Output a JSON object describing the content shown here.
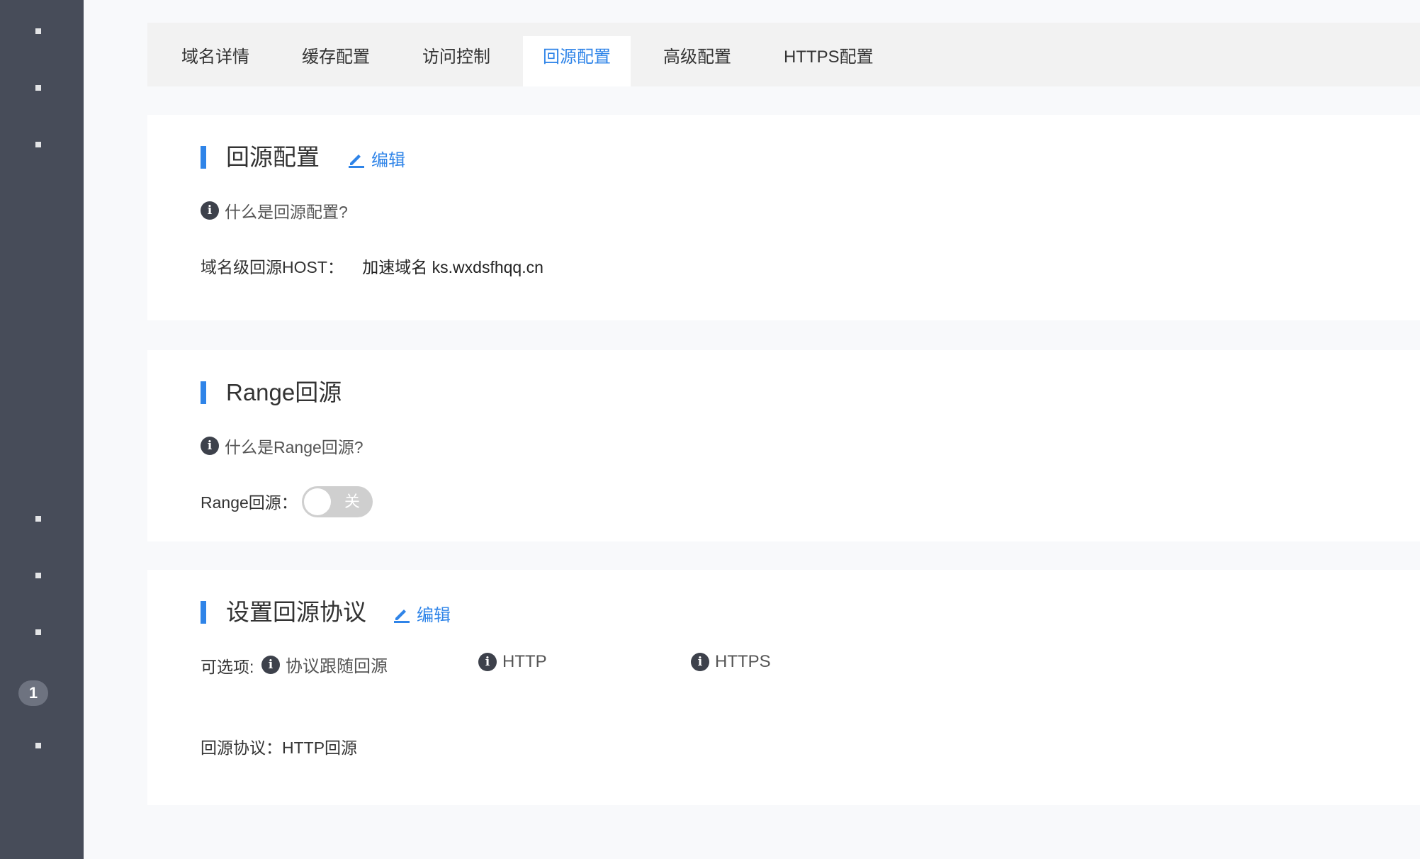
{
  "sidebar": {
    "badge": "1"
  },
  "tabs": [
    {
      "label": "域名详情"
    },
    {
      "label": "缓存配置"
    },
    {
      "label": "访问控制"
    },
    {
      "label": "回源配置"
    },
    {
      "label": "高级配置"
    },
    {
      "label": "HTTPS配置"
    }
  ],
  "active_tab": "回源配置",
  "origin_section": {
    "title": "回源配置",
    "edit_label": "编辑",
    "help_text": "什么是回源配置?",
    "host_label": "域名级回源HOST：",
    "host_value": "加速域名 ks.wxdsfhqq.cn"
  },
  "range_section": {
    "title": "Range回源",
    "help_text": "什么是Range回源?",
    "field_label": "Range回源：",
    "toggle_label": "关",
    "toggle_on": false
  },
  "protocol_section": {
    "title": "设置回源协议",
    "edit_label": "编辑",
    "options_label": "可选项:",
    "options": [
      "协议跟随回源",
      "HTTP",
      "HTTPS"
    ],
    "current_label": "回源协议：",
    "current_value": "HTTP回源"
  },
  "colors": {
    "accent": "#2f84e8",
    "sidebar": "#474c59"
  }
}
